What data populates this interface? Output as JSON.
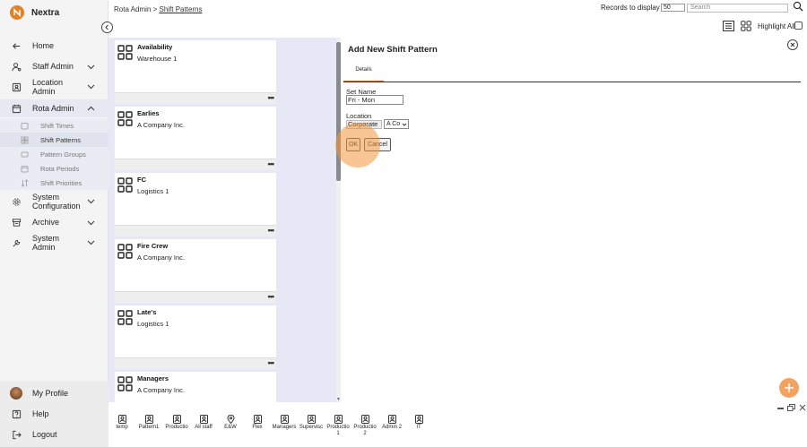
{
  "app": {
    "name": "Nextra",
    "brand_color": "#e67e22"
  },
  "nav": {
    "home": "Home",
    "staff_admin": "Staff Admin",
    "location_admin_l1": "Location",
    "location_admin_l2": "Admin",
    "rota_admin": "Rota Admin",
    "sub": {
      "shift_times": "Shift Times",
      "shift_patterns": "Shift Patterns",
      "pattern_groups": "Pattern Groups",
      "rota_periods": "Rota Periods",
      "shift_priorities": "Shift Priorities"
    },
    "system_config_l1": "System",
    "system_config_l2": "Configuration",
    "archive": "Archive",
    "system_admin_l1": "System",
    "system_admin_l2": "Admin",
    "my_profile": "My Profile",
    "help": "Help",
    "logout": "Logout"
  },
  "header": {
    "breadcrumb_root": "Rota Admin",
    "breadcrumb_sep": " > ",
    "breadcrumb_current": "Shift Patterns",
    "records_label": "Records to display",
    "records_value": "50",
    "search_placeholder": "Search",
    "highlight_all": "Highlight All"
  },
  "cards": [
    {
      "title": "Availability",
      "subtitle": "Warehouse 1",
      "more": "•••"
    },
    {
      "title": "Earlies",
      "subtitle": "A Company Inc.",
      "more": "•••"
    },
    {
      "title": "FC",
      "subtitle": "Logistics 1",
      "more": "•••"
    },
    {
      "title": "Fire Crew",
      "subtitle": "A Company Inc.",
      "more": "•••"
    },
    {
      "title": "Late's",
      "subtitle": "Logistics 1",
      "more": "•••"
    },
    {
      "title": "Managers",
      "subtitle": "A Company Inc.",
      "more": ""
    }
  ],
  "dialog": {
    "title": "Add New Shift Pattern",
    "tab": "Details",
    "set_name_label": "Set Name",
    "set_name_value": "Fri - Mon",
    "location_label": "Location",
    "location_value": "Corporate",
    "location_select": "A Co",
    "ok": "OK",
    "cancel": "Cancel"
  },
  "tray": [
    {
      "l1": "temp",
      "l2": ""
    },
    {
      "l1": "Pattern1",
      "l2": ""
    },
    {
      "l1": "Productio",
      "l2": ""
    },
    {
      "l1": "All staff",
      "l2": ""
    },
    {
      "l1": "E&W",
      "l2": ""
    },
    {
      "l1": "Flex",
      "l2": ""
    },
    {
      "l1": "Managers",
      "l2": ""
    },
    {
      "l1": "Supervisc",
      "l2": ""
    },
    {
      "l1": "Productio",
      "l2": "1"
    },
    {
      "l1": "Productio",
      "l2": "2"
    },
    {
      "l1": "Admin 2",
      "l2": ""
    },
    {
      "l1": "IT",
      "l2": ""
    }
  ],
  "colors": {
    "accent": "#c86a2c",
    "content_bg": "#e6e9f5",
    "fab": "#f3a261"
  }
}
